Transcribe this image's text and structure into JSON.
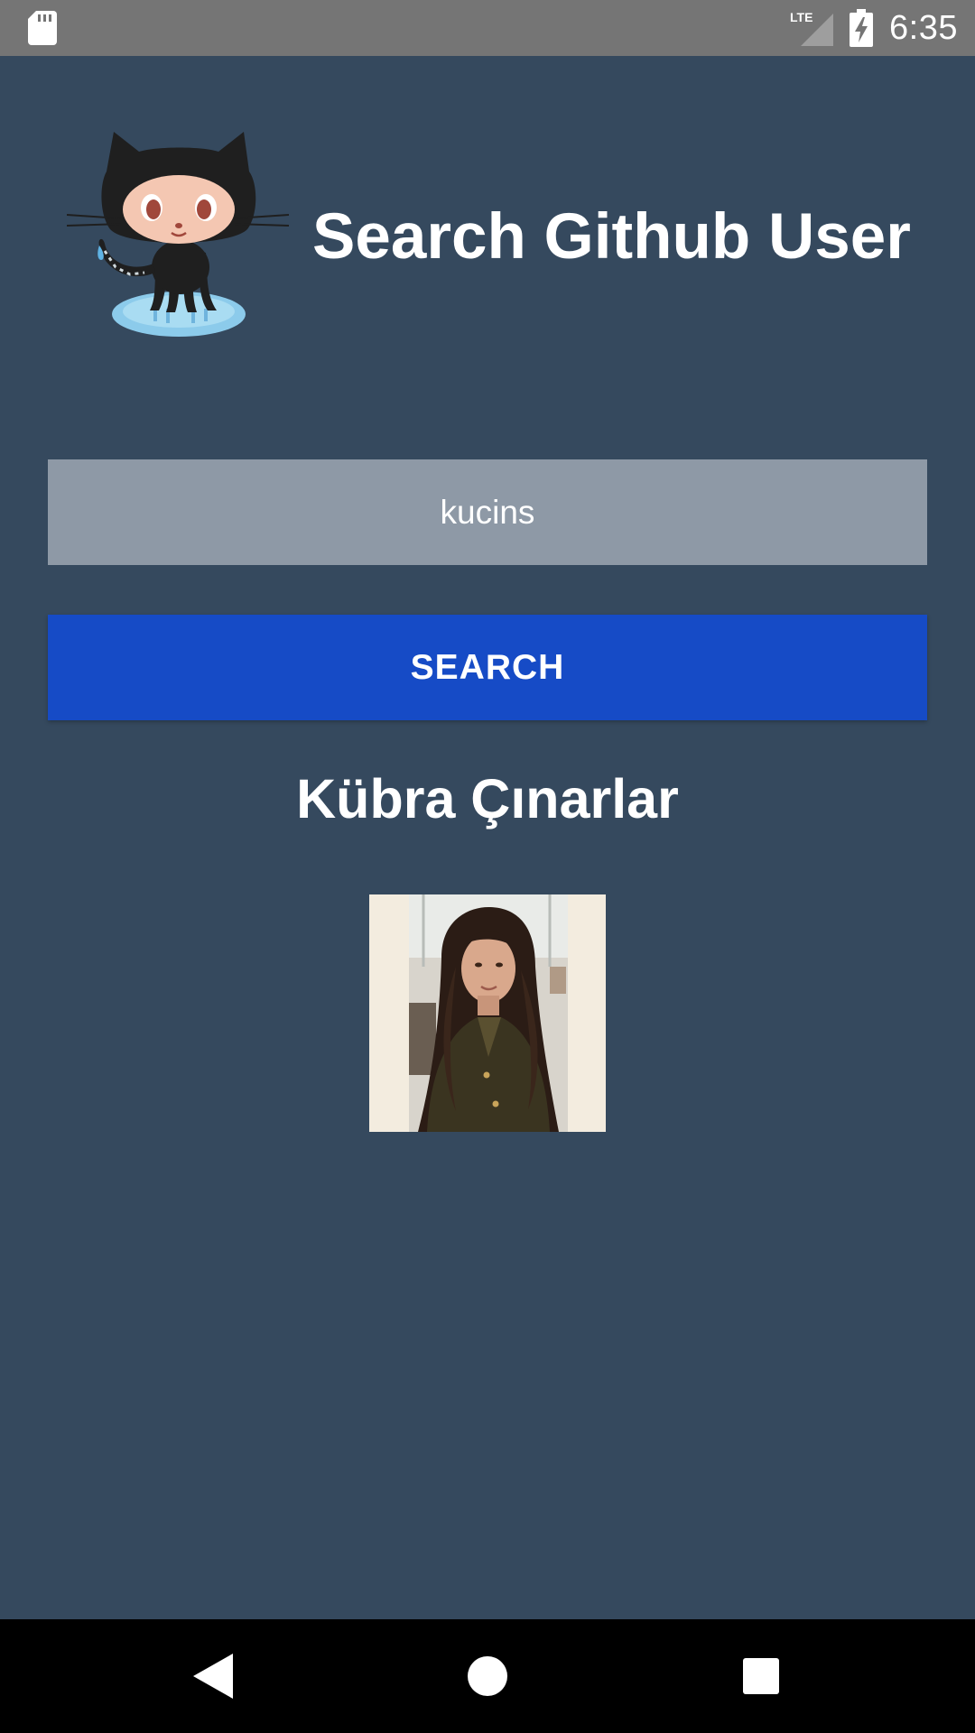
{
  "status_bar": {
    "time": "6:35",
    "network_label": "LTE",
    "icons": [
      "sd-card-icon",
      "lte-signal-icon",
      "battery-charging-icon"
    ]
  },
  "header": {
    "title": "Search Github User",
    "logo_icon": "octocat-icon"
  },
  "search": {
    "value": "kucins",
    "button_label": "SEARCH"
  },
  "result": {
    "user_name": "Kübra Çınarlar",
    "avatar_icon": "profile-photo"
  },
  "navigation": {
    "icons": [
      "back-icon",
      "home-icon",
      "recents-icon"
    ]
  },
  "colors": {
    "background": "#35495e",
    "status_bar": "#757575",
    "input_background": "#8e99a6",
    "button": "#164bc6",
    "nav_bar": "#000000",
    "text": "#ffffff"
  }
}
